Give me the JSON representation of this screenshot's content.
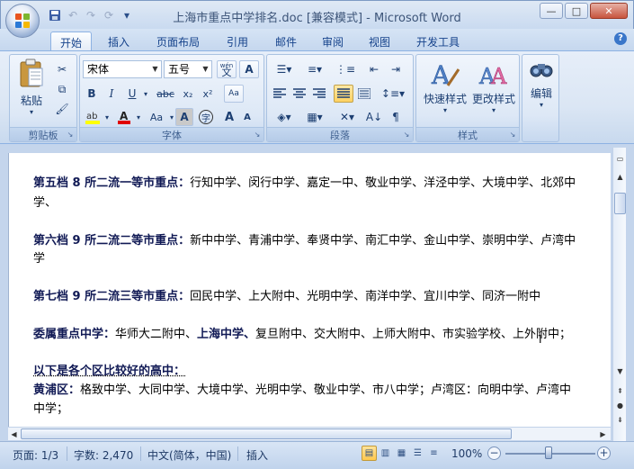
{
  "window": {
    "title": "上海市重点中学排名.doc [兼容模式] - Microsoft Word",
    "min": "—",
    "max": "□",
    "close": "✕"
  },
  "qat": {
    "save": "save-icon",
    "undo": "↶",
    "redo": "↷",
    "more": "▾"
  },
  "tabs": [
    {
      "label": "开始",
      "active": true
    },
    {
      "label": "插入"
    },
    {
      "label": "页面布局"
    },
    {
      "label": "引用"
    },
    {
      "label": "邮件"
    },
    {
      "label": "审阅"
    },
    {
      "label": "视图"
    },
    {
      "label": "开发工具"
    }
  ],
  "ribbon": {
    "clipboard": {
      "label": "剪贴板",
      "paste": "粘贴",
      "paste_arrow": "▾"
    },
    "font": {
      "label": "字体",
      "font_name": "宋体",
      "font_size": "五号",
      "wen": "wén",
      "wen_char": "文",
      "A_box": "A",
      "bold": "B",
      "italic": "I",
      "underline": "U",
      "strike": "abc",
      "sub": "x₂",
      "sup": "x²",
      "clear": "Aa",
      "change_case": "Aa",
      "char_shading": "A",
      "enclose": "字",
      "grow": "A",
      "shrink": "A"
    },
    "paragraph": {
      "label": "段落"
    },
    "styles": {
      "label": "样式",
      "quick": "快速样式",
      "change": "更改样式"
    },
    "editing": {
      "label": "编辑"
    }
  },
  "document": {
    "lines": [
      {
        "bold": "第五档 8 所二流一等市重点：",
        "text": "行知中学、闵行中学、嘉定一中、敬业中学、洋泾中学、大境中学、北郊中"
      },
      {
        "bold": "",
        "text": "学、"
      },
      {
        "bold": "第六档 9 所二流二等市重点：",
        "text": "新中中学、青浦中学、奉贤中学、南汇中学、金山中学、崇明中学、卢湾中"
      },
      {
        "bold": "",
        "text": "学"
      },
      {
        "bold": "第七档 9 所二流三等市重点：",
        "text": "回民中学、上大附中、光明中学、南洋中学、宜川中学、同济一附中"
      },
      {
        "bold": "委属重点中学：",
        "text_a": "华师大二附中、",
        "bold2": "上海中学、",
        "text": "复旦附中、交大附中、上师大附中、市实验学校、上外附中；"
      },
      {
        "bold": "以下是各个区比较好的高中：",
        "text": ""
      },
      {
        "bold": "黄浦区：",
        "text": "格致中学、大同中学、大境中学、光明中学、敬业中学、市八中学；卢湾区：向明中学、卢湾中"
      },
      {
        "bold": "",
        "text": "中学；"
      }
    ]
  },
  "status": {
    "page": "页面: 1/3",
    "words": "字数: 2,470",
    "lang": "中文(简体，中国)",
    "mode": "插入",
    "zoom": "100%",
    "zoom_out": "−",
    "zoom_in": "+"
  }
}
